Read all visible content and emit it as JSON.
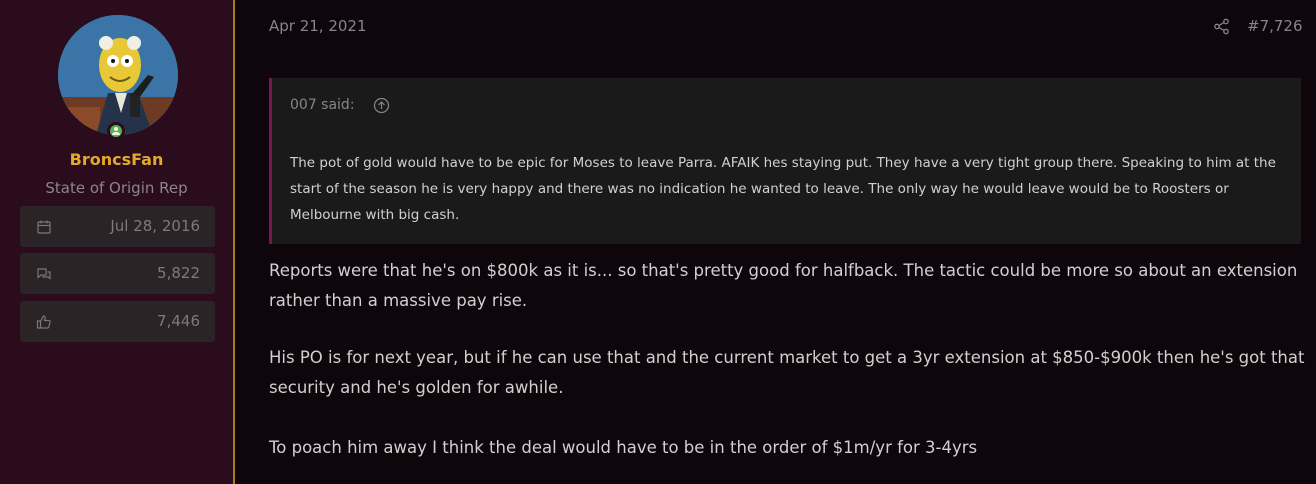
{
  "user": {
    "name": "BroncsFan",
    "title": "State of Origin Rep",
    "stats": [
      {
        "icon": "calendar-icon",
        "value": "Jul 28, 2016"
      },
      {
        "icon": "messages-icon",
        "value": "5,822"
      },
      {
        "icon": "thumbs-up-icon",
        "value": "7,446"
      }
    ]
  },
  "post": {
    "date": "Apr 21, 2021",
    "number": "#7,726",
    "quote": {
      "author": "007 said:",
      "text": "The pot of gold would have to be epic for Moses to leave Parra. AFAIK hes staying put. They have a very tight group there. Speaking to him at the start of the season he is very happy and there was no indication he wanted to leave. The only way he would leave would be to Roosters or Melbourne with big cash."
    },
    "paragraphs": [
      "Reports were that he's on $800k as it is... so that's pretty good for halfback. The tactic could be more so about an extension rather than a massive pay rise.",
      "His PO is for next year, but if he can use that and the current market to get a 3yr extension at $850-$900k then he's got that security and he's golden for awhile.",
      "To poach him away I think the deal would have to be in the order of $1m/yr for 3-4yrs"
    ]
  },
  "colors": {
    "sidebar_bg": "#2a0c1c",
    "username": "#e3aa2a",
    "accent_rule": "#a57e14",
    "quote_border": "#7a1452",
    "online": "#5eae52"
  }
}
